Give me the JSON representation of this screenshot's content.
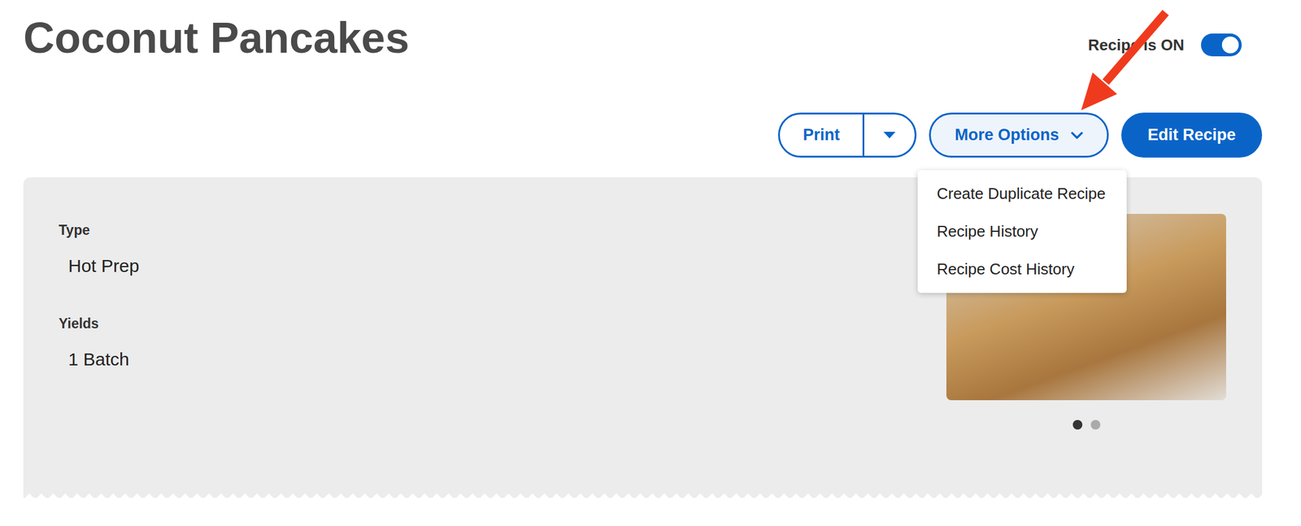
{
  "page": {
    "title": "Coconut Pancakes"
  },
  "toggle": {
    "label": "Recipe is ON",
    "on": true
  },
  "actions": {
    "print": {
      "label": "Print"
    },
    "more_options": {
      "label": "More Options",
      "expanded": true
    },
    "edit": {
      "label": "Edit Recipe"
    }
  },
  "menu": {
    "items": [
      "Create Duplicate Recipe",
      "Recipe History",
      "Recipe Cost History"
    ]
  },
  "details": [
    {
      "label": "Type",
      "value": "Hot Prep"
    },
    {
      "label": "Yields",
      "value": "1 Batch"
    }
  ],
  "carousel": {
    "dots": [
      {
        "selected": true
      },
      {
        "selected": false
      }
    ]
  }
}
